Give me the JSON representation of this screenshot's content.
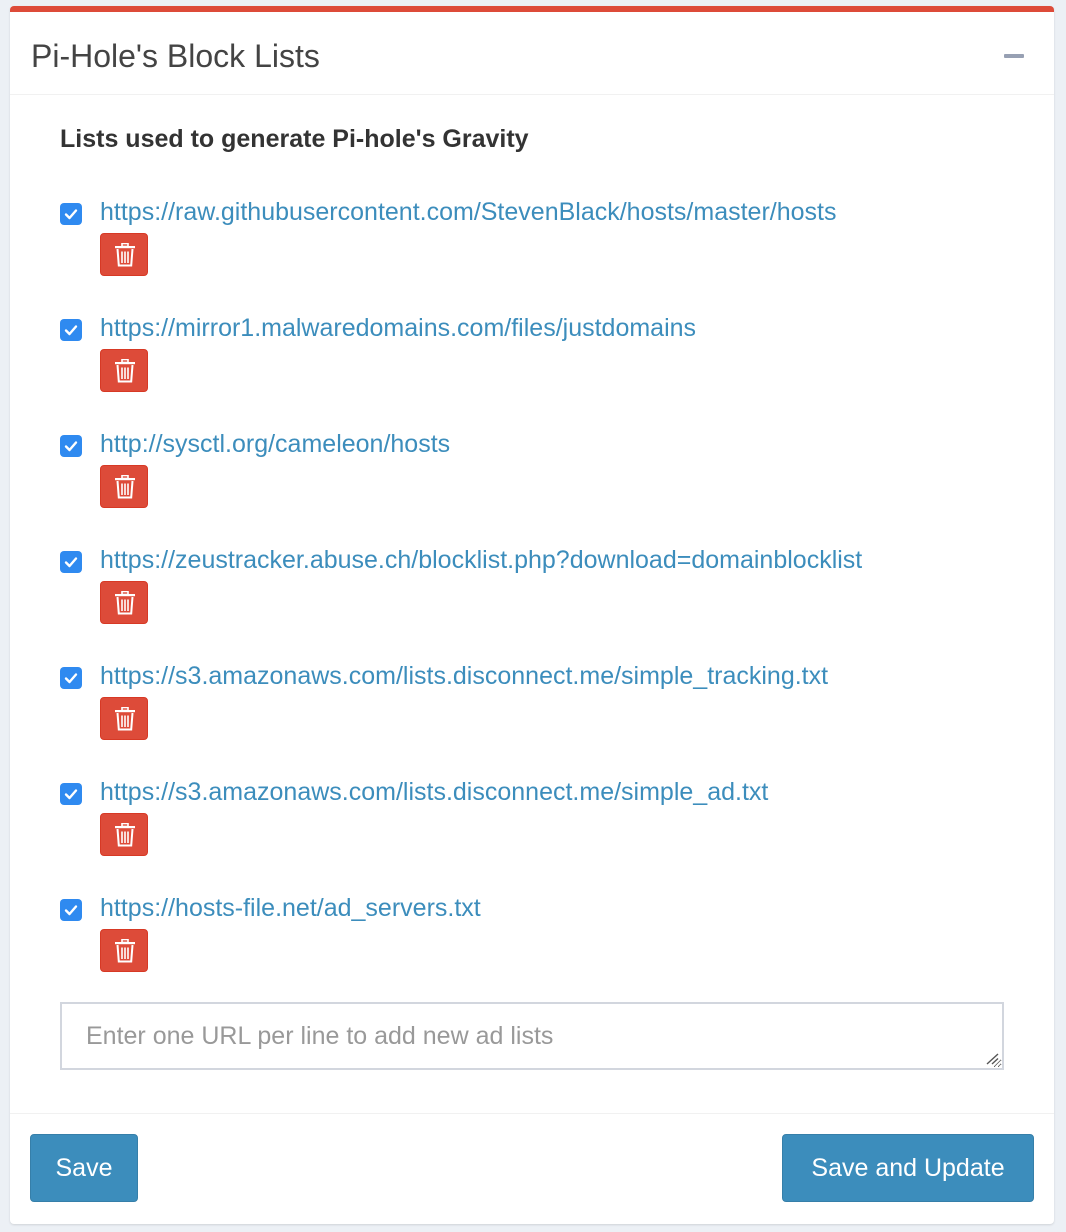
{
  "header": {
    "title": "Pi-Hole's Block Lists",
    "collapse_icon": "minus-icon"
  },
  "body": {
    "heading": "Lists used to generate Pi-hole's Gravity",
    "lists": [
      {
        "url": "https://raw.githubusercontent.com/StevenBlack/hosts/master/hosts",
        "checked": true
      },
      {
        "url": "https://mirror1.malwaredomains.com/files/justdomains",
        "checked": true
      },
      {
        "url": "http://sysctl.org/cameleon/hosts",
        "checked": true
      },
      {
        "url": "https://zeustracker.abuse.ch/blocklist.php?download=domainblocklist",
        "checked": true
      },
      {
        "url": "https://s3.amazonaws.com/lists.disconnect.me/simple_tracking.txt",
        "checked": true
      },
      {
        "url": "https://s3.amazonaws.com/lists.disconnect.me/simple_ad.txt",
        "checked": true
      },
      {
        "url": "https://hosts-file.net/ad_servers.txt",
        "checked": true
      }
    ],
    "new_lists_placeholder": "Enter one URL per line to add new ad lists",
    "new_lists_value": ""
  },
  "footer": {
    "save_label": "Save",
    "save_update_label": "Save and Update"
  },
  "colors": {
    "accent_top_border": "#dd4b39",
    "link": "#3c8dbc",
    "checkbox": "#2f8af0",
    "delete_button": "#dd4b39",
    "primary_button": "#3c8dbc"
  }
}
